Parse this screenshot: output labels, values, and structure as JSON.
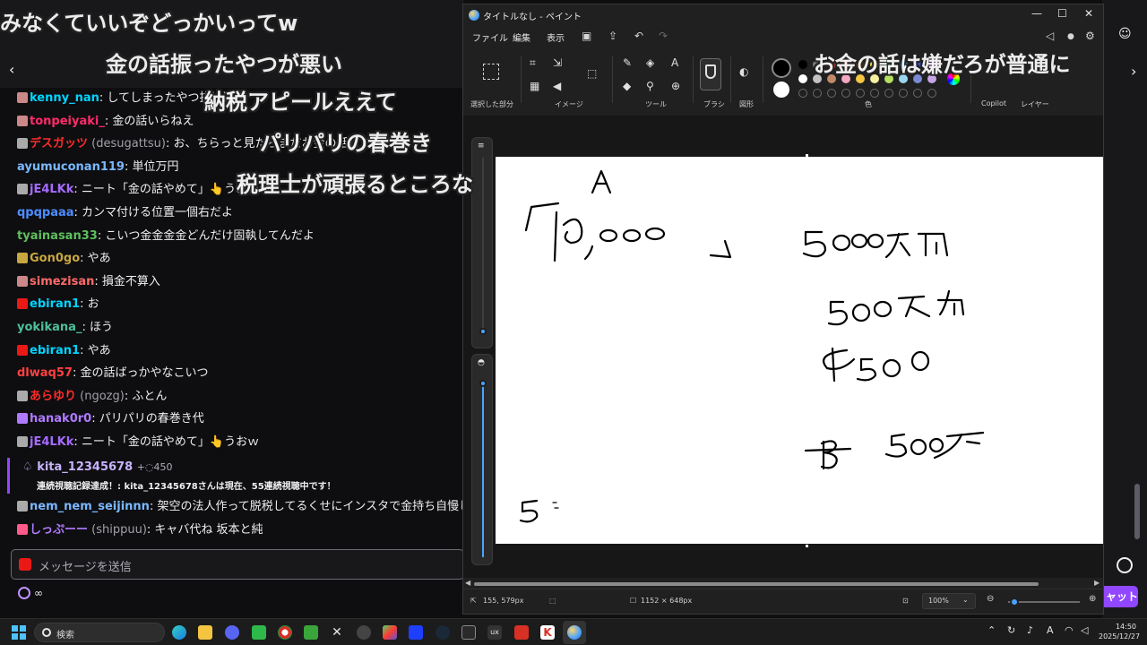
{
  "chat": {
    "back_icon": "chevron-left-icon",
    "messages": [
      {
        "user": "kenny_nan",
        "color": "#00d4ff",
        "badge": "#c88",
        "text": ": してしまったやつ抜け返す"
      },
      {
        "user": "tonpeiyaki_",
        "color": "#ff2b6b",
        "badge": "#c88",
        "text": ": 金の話いらねえ"
      },
      {
        "user": "デスガッツ",
        "color": "#ff2b2b",
        "sub": " (desugattsu)",
        "badge": "#aaa",
        "text": ": お、ちらっと見たらまだお金の話してる"
      },
      {
        "user": "ayumuconan119",
        "color": "#7ab8ff",
        "badge": "",
        "text": ": 単位万円"
      },
      {
        "user": "jE4LKk",
        "color": "#a56bff",
        "badge": "#aaa",
        "text": ": ニート「金の話やめて」👆うおｗｗ"
      },
      {
        "user": "qpqpaaa",
        "color": "#4d8dff",
        "badge": "",
        "text": ": カンマ付ける位置一個右だよ"
      },
      {
        "user": "tyainasan33",
        "color": "#5fbf5f",
        "badge": "",
        "text": ": こいつ金金金金どんだけ固執してんだよ"
      },
      {
        "user": "Gon0go",
        "color": "#c8a640",
        "badge": "#c8a640",
        "text": ": やあ"
      },
      {
        "user": "simezisan",
        "color": "#ff6a6a",
        "badge": "#c88",
        "text": ": 損金不算入"
      },
      {
        "user": "ebiran1",
        "color": "#00d4ff",
        "badge": "#e91916",
        "text": ": お"
      },
      {
        "user": "yokikana_",
        "color": "#4dbf9a",
        "badge": "",
        "text": ": ほう"
      },
      {
        "user": "ebiran1",
        "color": "#00d4ff",
        "badge": "#e91916",
        "text": ": やあ"
      },
      {
        "user": "dlwaq57",
        "color": "#ff4040",
        "badge": "",
        "text": ": 金の話ばっかやなこいつ"
      },
      {
        "user": "あらゆり",
        "color": "#ff2b2b",
        "sub": " (ngozg)",
        "badge": "#aaa",
        "text": ": ふとん"
      },
      {
        "user": "hanak0r0",
        "color": "#b07aff",
        "badge": "#b07aff",
        "text": ": パリパリの春巻き代"
      },
      {
        "user": "jE4LKk",
        "color": "#a56bff",
        "badge": "#aaa",
        "text": ": ニート「金の話やめて」👆うおｗ"
      }
    ],
    "highlight": {
      "user": "kita_12345678",
      "points": "+◌450",
      "text": "連続視聴記録達成！: kita_12345678さんは現在、55連続視聴中です！"
    },
    "after": [
      {
        "user": "nem_nem_seijinnn",
        "color": "#7ab8ff",
        "badge": "#aaa",
        "text": ": 架空の法人作って脱税してるくせにインスタで金持ち自慢し"
      },
      {
        "user": "しっぷーー",
        "color": "#b07aff",
        "sub": " (shippuu)",
        "badge": "#ff5a8a",
        "text": ": キャバ代ね 坂本と純"
      }
    ],
    "send_placeholder": "メッセージを送信",
    "points_label": "∞",
    "chat_button": "ャット"
  },
  "paint": {
    "title": "タイトルなし - ペイント",
    "window_controls": {
      "minimize": "—",
      "maximize": "☐",
      "close": "✕"
    },
    "menu": [
      "ファイル",
      "編集",
      "表示"
    ],
    "ribbon_groups": {
      "selection": "選択した部分",
      "image": "イメージ",
      "tools": "ツール",
      "brush": "ブラシ",
      "shapes": "図形",
      "colors": "色",
      "copilot": "Copilot",
      "layers": "レイヤー"
    },
    "tool_text": "A",
    "canvas_text": {
      "a_label": "A",
      "first_amount": "「10,000 」",
      "amount1": "5000万円",
      "amount2": "500万円",
      "amount3": "4500",
      "b_label": "B",
      "amount4": "500万",
      "bottom": "5"
    },
    "status": {
      "cursor": "155, 579px",
      "size": "1152 × 648px",
      "zoom": "100%"
    },
    "palette_row1": [
      "#000000",
      "#7f7f7f",
      "#b04040",
      "#e0403a",
      "#f08a30",
      "#f7e14a",
      "#4cc35a",
      "#3aa7d6",
      "#3a4bd6",
      "#a04ad6"
    ],
    "palette_row2": [
      "#ffffff",
      "#c3c3c3",
      "#c08a6a",
      "#f3a7c0",
      "#f5c542",
      "#f4f0a0",
      "#b5e061",
      "#9ad6f0",
      "#7a8ad6",
      "#c8a6e6"
    ]
  },
  "overlay_comments": [
    {
      "text": "みなくていいぞどっかいってw"
    },
    {
      "text": "金の話振ったやつが悪い"
    },
    {
      "text": "納税アピールええて"
    },
    {
      "text": "パリパリの春巻き"
    },
    {
      "text": "税理士が頑張るところな"
    },
    {
      "text": "お金の話は嫌だろが普通に"
    }
  ],
  "taskbar": {
    "search_label": "検索",
    "time": "14:50",
    "date": "2025/12/27",
    "ime": "A"
  }
}
